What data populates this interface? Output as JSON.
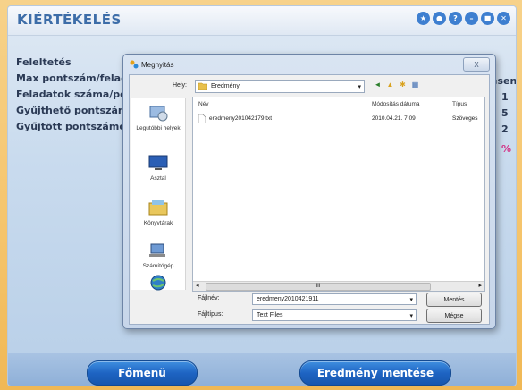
{
  "app": {
    "title": "KIÉRTÉKELÉS",
    "stats": [
      {
        "label": "Feleltetés",
        "value": ""
      },
      {
        "label": "Max pontszám/felada",
        "value": "esen"
      },
      {
        "label": "Feladatok száma/pont",
        "value": "1"
      },
      {
        "label": "Gyűjthető pontszámo",
        "value": "5"
      },
      {
        "label": "Gyűjtött pontszámok",
        "value": "2"
      },
      {
        "label": "",
        "value": "%"
      }
    ],
    "buttons": {
      "main_menu": "Főmenü",
      "save_result": "Eredmény mentése"
    }
  },
  "dialog": {
    "title": "Megnyitás",
    "close": "X",
    "location_label": "Hely:",
    "location_value": "Eredmény",
    "places": [
      {
        "label": "Legutóbbi helyek"
      },
      {
        "label": "Asztal"
      },
      {
        "label": "Könyvtárak"
      },
      {
        "label": "Számítógép"
      },
      {
        "label": ""
      }
    ],
    "columns": {
      "name": "Név",
      "modified": "Módosítás dátuma",
      "type": "Típus"
    },
    "files": [
      {
        "name": "eredmeny201042179.txt",
        "modified": "2010.04.21. 7:09",
        "type": "Szöveges"
      }
    ],
    "filename_label": "Fájlnév:",
    "filename_value": "eredmeny2010421911",
    "filetype_label": "Fájltípus:",
    "filetype_value": "Text Files",
    "save_button": "Mentés",
    "cancel_button": "Mégse",
    "scroll_mid": "III"
  },
  "colors": {
    "accent": "#1e64c3",
    "title": "#3d6da8"
  }
}
